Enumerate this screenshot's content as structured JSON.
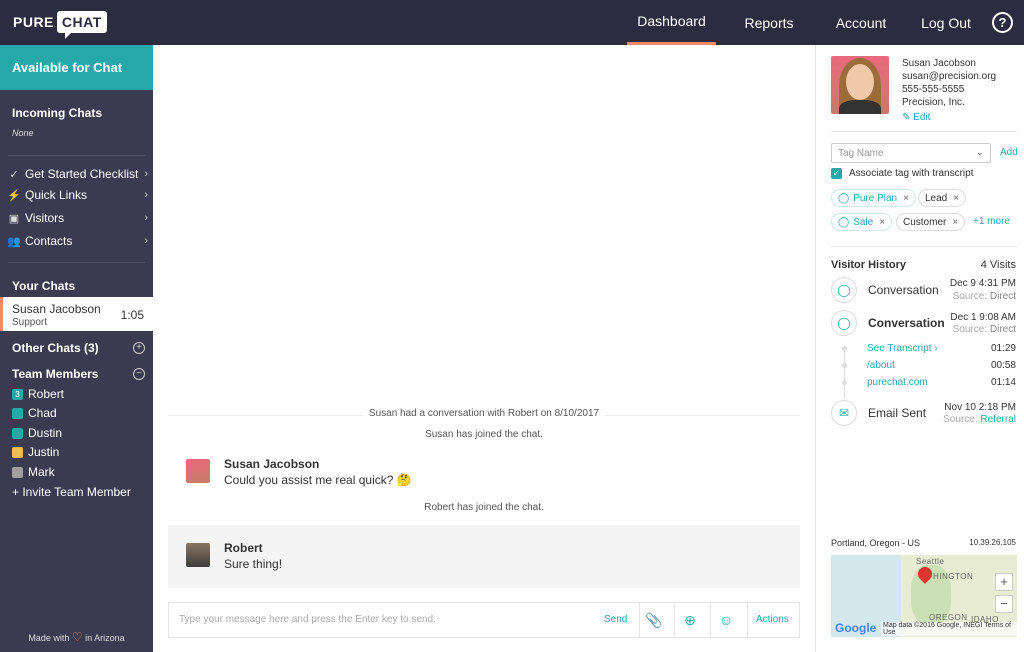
{
  "logo": {
    "pure": "PURE",
    "chat": "CHAT"
  },
  "nav": {
    "dashboard": "Dashboard",
    "reports": "Reports",
    "account": "Account",
    "logout": "Log Out",
    "help": "?"
  },
  "sidebar": {
    "status": "Available for Chat",
    "incoming_title": "Incoming Chats",
    "incoming_none": "None",
    "links": [
      {
        "label": "Get Started Checklist",
        "icon": "check-icon"
      },
      {
        "label": "Quick Links",
        "icon": "bolt-icon"
      },
      {
        "label": "Visitors",
        "icon": "visitors-icon"
      },
      {
        "label": "Contacts",
        "icon": "contacts-icon"
      }
    ],
    "your_chats_title": "Your Chats",
    "active_chat": {
      "name": "Susan Jacobson",
      "dept": "Support",
      "time": "1:05"
    },
    "other_chats": "Other Chats (3)",
    "team_title": "Team Members",
    "members": [
      {
        "name": "Robert",
        "color": "#27a8a8",
        "badge": "3"
      },
      {
        "name": "Chad",
        "color": "#27a8a8",
        "badge": ""
      },
      {
        "name": "Dustin",
        "color": "#27a8a8",
        "badge": ""
      },
      {
        "name": "Justin",
        "color": "#f0b95a",
        "badge": ""
      },
      {
        "name": "Mark",
        "color": "#a0a0a0",
        "badge": ""
      }
    ],
    "invite": "+ Invite Team Member",
    "made_with": "Made with",
    "in_arizona": "in Arizona"
  },
  "chat": {
    "history_line": "Susan had a conversation with Robert on 8/10/2017",
    "susan_joined": "Susan has joined the chat.",
    "msg1_name": "Susan Jacobson",
    "msg1_text": "Could you assist me real quick? 🤔",
    "robert_joined": "Robert has joined the chat.",
    "msg2_name": "Robert",
    "msg2_text": "Sure thing!",
    "input_placeholder": "Type your message here and press the Enter key to send.",
    "send": "Send",
    "actions": "Actions"
  },
  "visitor": {
    "name": "Susan Jacobson",
    "email": "susan@precision.org",
    "phone": "555-555-5555",
    "company": "Precision, Inc.",
    "edit": "Edit",
    "tag_placeholder": "Tag Name",
    "add": "Add",
    "associate": "Associate tag with transcript",
    "tags": [
      "Pure Plan",
      "Lead",
      "Sale",
      "Customer"
    ],
    "more_tags": "+1 more",
    "history_title": "Visitor History",
    "visits": "4 Visits",
    "history": [
      {
        "label": "Conversation",
        "date": "Dec 9 4:31 PM",
        "source_label": "Source:",
        "source": "Direct"
      },
      {
        "label": "Conversation",
        "date": "Dec 1 9:08 AM",
        "source_label": "Source:",
        "source": "Direct"
      },
      {
        "label": "Email Sent",
        "date": "Nov 10 2:18 PM",
        "source_label": "Source:",
        "source": "Referral"
      }
    ],
    "pages": [
      {
        "label": "See Transcript ›",
        "time": "01:29"
      },
      {
        "label": "/about",
        "time": "00:58"
      },
      {
        "label": "purechat.com",
        "time": "01:14"
      }
    ],
    "location": "Portland, Oregon - US",
    "ip": "10.39.26.105",
    "map": {
      "seattle": "Seattle",
      "washington": "HINGTON",
      "oregon": "OREGON",
      "idaho": "IDAHO",
      "google": "Google",
      "attribution": "Map data ©2016 Google, INEGI   Terms of Use"
    }
  },
  "colors": {
    "accent": "#27a8a8",
    "nav_bg": "#2b2c3f",
    "sidebar_bg": "#3a3b50",
    "active_underline": "#f08a6c"
  }
}
